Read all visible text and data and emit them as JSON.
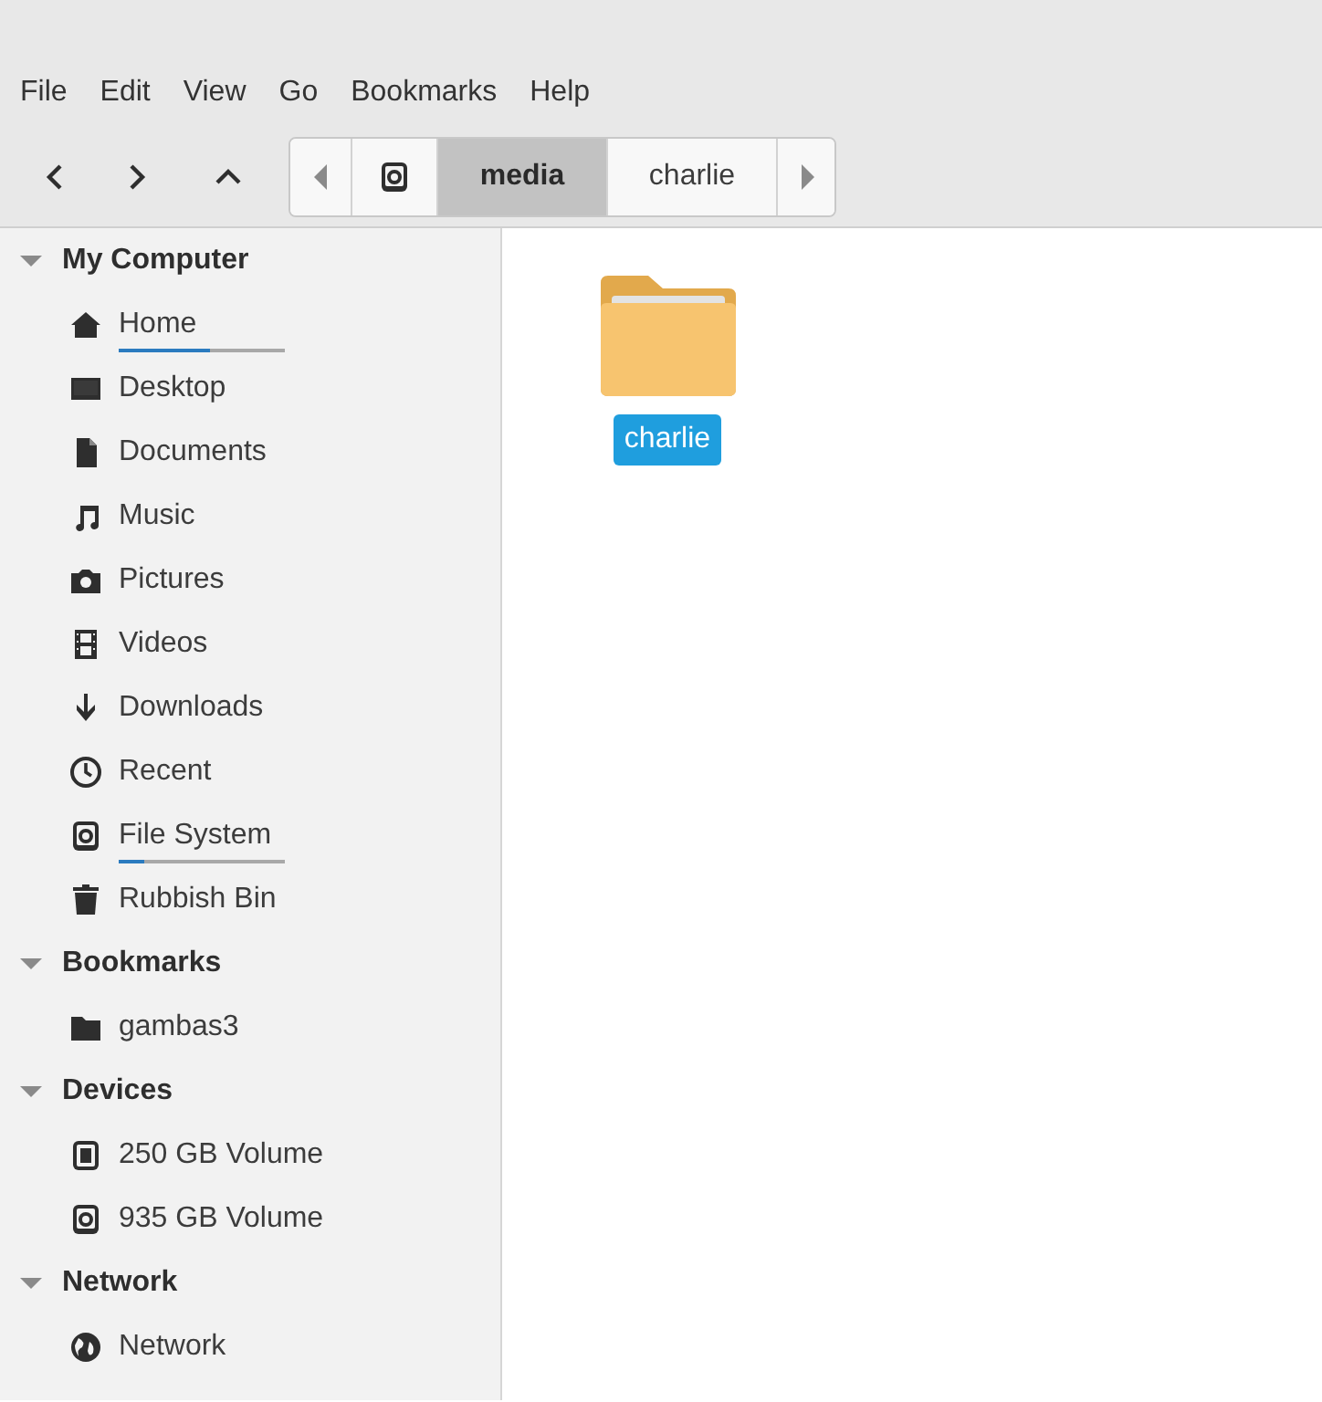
{
  "menu_bar": [
    "File",
    "Edit",
    "View",
    "Go",
    "Bookmarks",
    "Help"
  ],
  "path_bar": {
    "segments": [
      {
        "label": "media",
        "selected": true
      },
      {
        "label": "charlie",
        "selected": false
      }
    ]
  },
  "sidebar": {
    "sections": [
      {
        "title": "My Computer",
        "expanded": true,
        "items": [
          {
            "label": "Home",
            "level": 0.55
          },
          {
            "label": "Desktop"
          },
          {
            "label": "Documents"
          },
          {
            "label": "Music"
          },
          {
            "label": "Pictures"
          },
          {
            "label": "Videos"
          },
          {
            "label": "Downloads"
          },
          {
            "label": "Recent"
          },
          {
            "label": "File System",
            "level": 0.15
          },
          {
            "label": "Rubbish Bin"
          }
        ]
      },
      {
        "title": "Bookmarks",
        "expanded": true,
        "items": [
          {
            "label": "gambas3"
          }
        ]
      },
      {
        "title": "Devices",
        "expanded": true,
        "items": [
          {
            "label": "250 GB Volume"
          },
          {
            "label": "935 GB Volume"
          }
        ]
      },
      {
        "title": "Network",
        "expanded": true,
        "items": [
          {
            "label": "Network"
          }
        ]
      }
    ]
  },
  "files": [
    {
      "name": "charlie",
      "selected": true
    }
  ]
}
